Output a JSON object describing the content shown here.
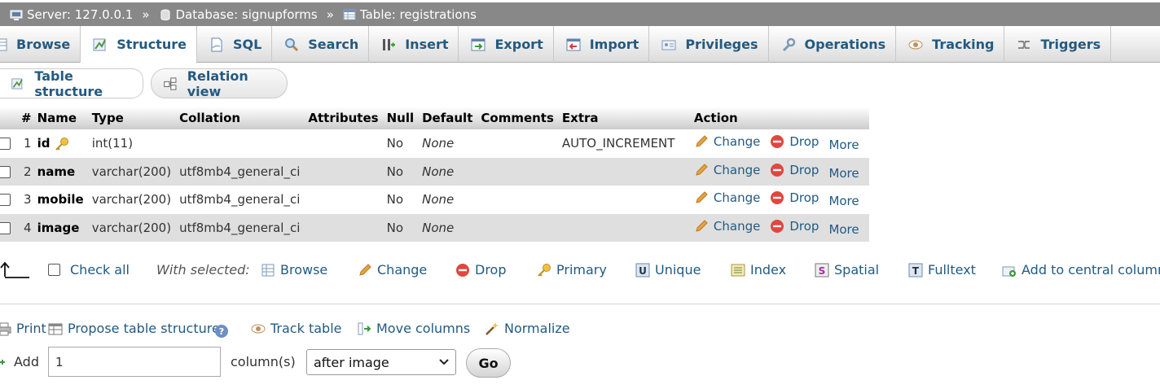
{
  "breadcrumb": {
    "server": "Server: 127.0.0.1",
    "database": "Database: signupforms",
    "table": "Table: registrations",
    "separator": "»"
  },
  "tabs": [
    {
      "label": "Browse",
      "icon": "browse-icon"
    },
    {
      "label": "Structure",
      "icon": "structure-icon",
      "active": true
    },
    {
      "label": "SQL",
      "icon": "sql-icon"
    },
    {
      "label": "Search",
      "icon": "search-icon"
    },
    {
      "label": "Insert",
      "icon": "insert-icon"
    },
    {
      "label": "Export",
      "icon": "export-icon"
    },
    {
      "label": "Import",
      "icon": "import-icon"
    },
    {
      "label": "Privileges",
      "icon": "privileges-icon"
    },
    {
      "label": "Operations",
      "icon": "wrench-icon"
    },
    {
      "label": "Tracking",
      "icon": "eye-icon"
    },
    {
      "label": "Triggers",
      "icon": "triggers-icon"
    }
  ],
  "subtabs": {
    "structure": "Table structure",
    "relation": "Relation view"
  },
  "table": {
    "headers": [
      "#",
      "Name",
      "Type",
      "Collation",
      "Attributes",
      "Null",
      "Default",
      "Comments",
      "Extra",
      "Action"
    ],
    "rows": [
      {
        "num": "1",
        "name": "id",
        "primary": true,
        "type": "int(11)",
        "collation": "",
        "attributes": "",
        "null": "No",
        "default": "None",
        "comments": "",
        "extra": "AUTO_INCREMENT"
      },
      {
        "num": "2",
        "name": "name",
        "primary": false,
        "type": "varchar(200)",
        "collation": "utf8mb4_general_ci",
        "attributes": "",
        "null": "No",
        "default": "None",
        "comments": "",
        "extra": ""
      },
      {
        "num": "3",
        "name": "mobile",
        "primary": false,
        "type": "varchar(200)",
        "collation": "utf8mb4_general_ci",
        "attributes": "",
        "null": "No",
        "default": "None",
        "comments": "",
        "extra": ""
      },
      {
        "num": "4",
        "name": "image",
        "primary": false,
        "type": "varchar(200)",
        "collation": "utf8mb4_general_ci",
        "attributes": "",
        "null": "No",
        "default": "None",
        "comments": "",
        "extra": ""
      }
    ],
    "actions": {
      "change": "Change",
      "drop": "Drop",
      "more": "More"
    }
  },
  "selection": {
    "check_all": "Check all",
    "with_selected": "With selected:",
    "browse": "Browse",
    "change": "Change",
    "drop": "Drop",
    "primary": "Primary",
    "unique": "Unique",
    "index": "Index",
    "spatial": "Spatial",
    "fulltext": "Fulltext",
    "central": "Add to central columns"
  },
  "bottom": {
    "print": "Print",
    "propose": "Propose table structure",
    "track": "Track table",
    "move": "Move columns",
    "normalize": "Normalize"
  },
  "add_columns": {
    "label": "Add",
    "count": "1",
    "suffix": "column(s)",
    "position": "after image",
    "go": "Go"
  },
  "colors": {
    "breadcrumb_bg": "#888888",
    "link": "#235a81",
    "row_alt": "#dfdfdf",
    "drop_red": "#e0473f",
    "pencil": "#e8a33b"
  }
}
